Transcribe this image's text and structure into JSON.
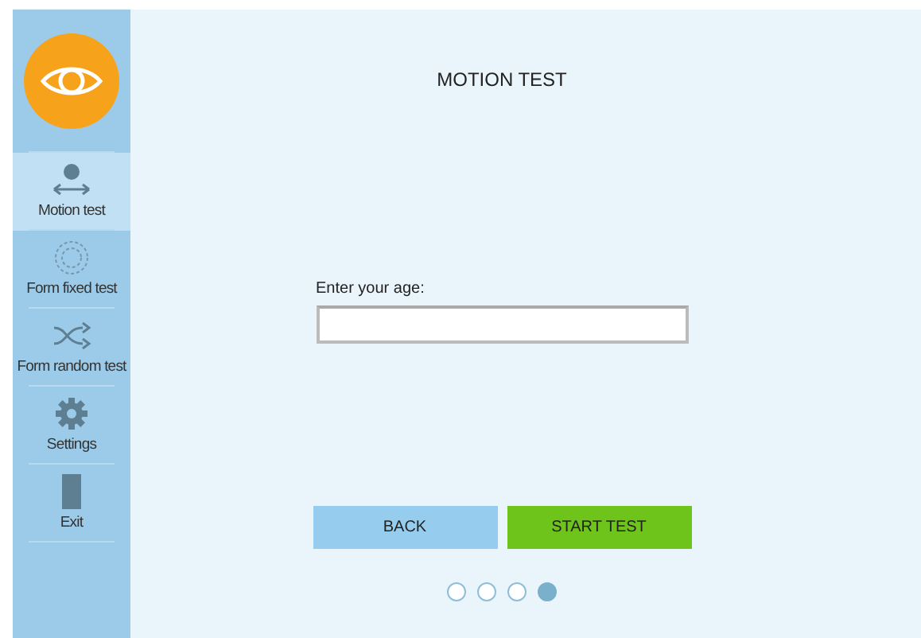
{
  "sidebar": {
    "items": [
      {
        "kind": "motion",
        "label": "Motion test",
        "selected": true
      },
      {
        "kind": "fixed",
        "label": "Form fixed test",
        "selected": false
      },
      {
        "kind": "random",
        "label": "Form random test",
        "selected": false
      },
      {
        "kind": "settings",
        "label": "Settings",
        "selected": false
      },
      {
        "kind": "exit",
        "label": "Exit",
        "selected": false
      }
    ]
  },
  "main": {
    "title": "MOTION TEST",
    "age_field": {
      "label": "Enter your age:"
    },
    "buttons": [
      {
        "kind": "back",
        "label": "BACK"
      },
      {
        "kind": "start",
        "label": "START TEST"
      }
    ],
    "pager": [
      {
        "selected": false
      },
      {
        "selected": false
      },
      {
        "selected": false
      },
      {
        "selected": true
      }
    ]
  }
}
